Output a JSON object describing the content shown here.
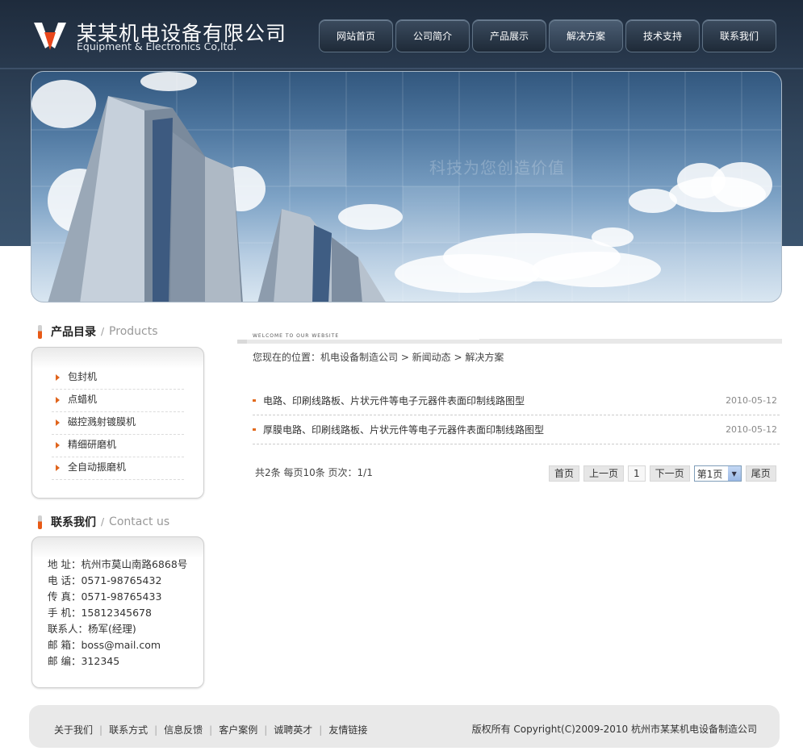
{
  "header": {
    "company_cn": "某某机电设备有限公司",
    "company_en": "Equipment & Electronics Co,ltd."
  },
  "nav": [
    {
      "label": "网站首页"
    },
    {
      "label": "公司简介"
    },
    {
      "label": "产品展示"
    },
    {
      "label": "解决方案",
      "active": true
    },
    {
      "label": "技术支持"
    },
    {
      "label": "联系我们"
    }
  ],
  "banner": {
    "slogan": "科技为您创造价值"
  },
  "products": {
    "title_cn": "产品目录",
    "sep": "/",
    "title_en": "Products",
    "items": [
      "包封机",
      "点蜡机",
      "磁控溅射镀膜机",
      "精细研磨机",
      "全自动振磨机"
    ]
  },
  "contact": {
    "title_cn": "联系我们",
    "sep": "/",
    "title_en": "Contact us",
    "lines": [
      "地  址：杭州市莫山南路6868号",
      "电  话：0571-98765432",
      "传  真：0571-98765433",
      "手  机：15812345678",
      "联系人：杨军(经理)",
      "邮  箱：boss@mail.com",
      "邮  编：312345"
    ]
  },
  "main": {
    "welcome": "WELCOME TO OUR WEBSITE",
    "breadcrumb": "您现在的位置：机电设备制造公司  > 新闻动态  > 解决方案",
    "news": [
      {
        "title": "电路、印刷线路板、片状元件等电子元器件表面印制线路图型",
        "date": "2010-05-12"
      },
      {
        "title": "厚膜电路、印刷线路板、片状元件等电子元器件表面印制线路图型",
        "date": "2010-05-12"
      }
    ],
    "pagination": {
      "info": "共2条  每页10条  页次：1/1",
      "first": "首页",
      "prev": "上一页",
      "current": "1",
      "next": "下一页",
      "select": "第1页",
      "last": "尾页"
    }
  },
  "footer": {
    "links": [
      "关于我们",
      "联系方式",
      "信息反馈",
      "客户案例",
      "诚聘英才",
      "友情链接"
    ],
    "copyright": "版权所有  Copyright(C)2009-2010 杭州市某某机电设备制造公司"
  },
  "colors": {
    "header_bg": "#27374b",
    "accent": "#e26a1d"
  }
}
